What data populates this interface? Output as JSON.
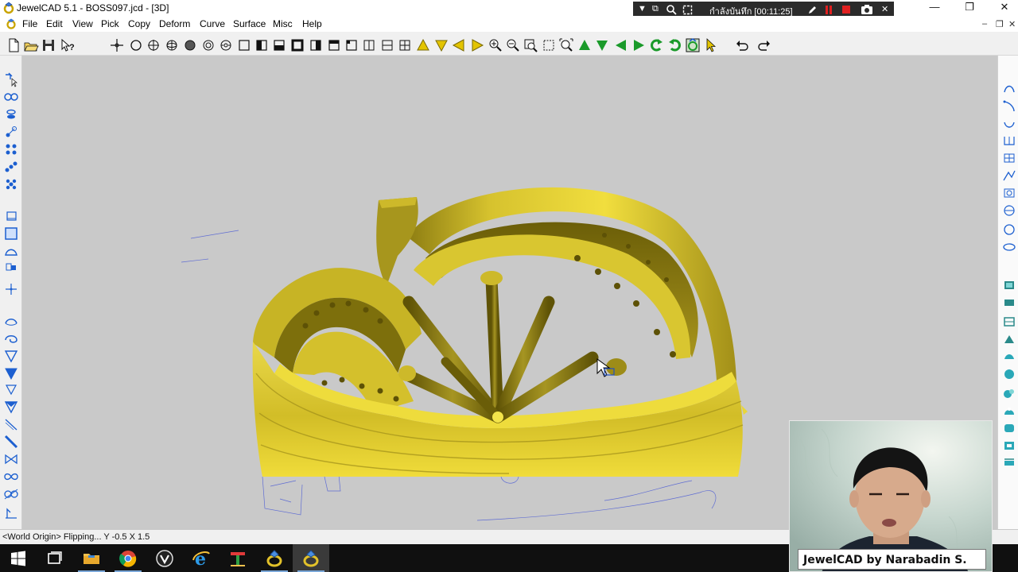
{
  "window": {
    "title": "JewelCAD 5.1 - BOSS097.jcd - [3D]",
    "controls": {
      "minimize": "—",
      "restore": "❐",
      "close": "✕"
    },
    "mdi_controls": {
      "minimize": "–",
      "restore": "❐",
      "close": "✕"
    }
  },
  "recorder": {
    "status": "กำลังบันทึก [00:11:25]"
  },
  "menu": {
    "items": [
      "File",
      "Edit",
      "View",
      "Pick",
      "Copy",
      "Deform",
      "Curve",
      "Surface",
      "Misc",
      "Help"
    ]
  },
  "toolbar": {
    "icons": [
      "new-file-icon",
      "open-file-icon",
      "save-icon",
      "help-icon",
      "crosshair-icon",
      "circle-icon",
      "target-icon",
      "sphere-icon",
      "disc-icon",
      "ring-icon",
      "torus-icon",
      "frame-icon",
      "window-icon",
      "window-bold-icon",
      "square-bold-icon",
      "split-right-icon",
      "split-top-icon",
      "split-left-icon",
      "split-vertical-icon",
      "split-horizontal-icon",
      "grid-icon",
      "arrow-up-yellow-icon",
      "arrow-down-yellow-icon",
      "arrow-left-yellow-icon",
      "arrow-right-yellow-icon",
      "zoom-in-icon",
      "zoom-out-icon",
      "zoom-window-icon",
      "zoom-box-icon",
      "zoom-all-icon",
      "arrow-up-green-icon",
      "arrow-down-green-icon",
      "arrow-left-green-icon",
      "arrow-right-green-icon",
      "rotate-left-green-icon",
      "rotate-right-green-icon",
      "render-icon",
      "pointer-icon",
      "undo-icon",
      "redo-icon"
    ]
  },
  "colors": {
    "viewport_bg": "#c9c9c9",
    "gold": "#d8c42a",
    "gold_dark": "#6e6108",
    "ui_blue": "#1c5fd0",
    "taskbar": "#101010"
  },
  "status": {
    "text": "<World Origin> Flipping...  Y  -0.5  X  1.5"
  },
  "taskbar": {
    "apps": [
      "windows-start",
      "task-view",
      "file-explorer",
      "chrome",
      "app-v-icon",
      "internet-explorer",
      "app-t-icon",
      "jewelcad-1",
      "jewelcad-2"
    ]
  },
  "webcam": {
    "caption": "JewelCAD by Narabadin S."
  }
}
